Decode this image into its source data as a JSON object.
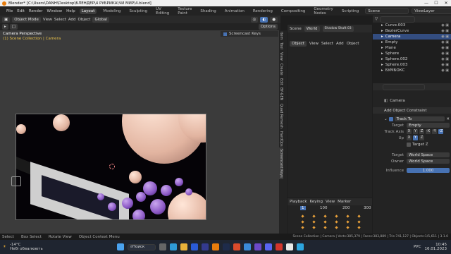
{
  "window": {
    "title": "Blender* [C:\\Users\\DANH\\Desktop\\БЛЕНДЕР\\4 РУБРИКА\\ЧИ МИР\\4.blend]",
    "controls": [
      "—",
      "☐",
      "✕"
    ]
  },
  "menu": {
    "items": [
      "File",
      "Edit",
      "Render",
      "Window",
      "Help"
    ],
    "workspaces": [
      "Layout",
      "Modeling",
      "Sculpting",
      "UV Editing",
      "Texture Paint",
      "Shading",
      "Animation",
      "Rendering",
      "Compositing",
      "Geometry Nodes",
      "Scripting"
    ],
    "active_workspace": "Layout",
    "scene": "Scene",
    "view_layer": "ViewLayer"
  },
  "viewport": {
    "mode": "Object Mode",
    "menus": [
      "View",
      "Select",
      "Add",
      "Object"
    ],
    "orientation": "Global",
    "options": "Options",
    "overlay_title": "Camera Perspective",
    "overlay_sub": "(1) Scene Collection | Camera"
  },
  "screencast": {
    "label": "Screencast Keys"
  },
  "sidebar_tabs": [
    "Item",
    "Tool",
    "View",
    "Create",
    "Edit",
    "BY-GEN",
    "Quad Remesh",
    "HardOps",
    "Screencast Keys"
  ],
  "mid_editor": {
    "label": "Scene",
    "sub": "Object",
    "menus": [
      "View",
      "Select",
      "Add",
      "Object"
    ],
    "world": "World",
    "dropdown": "Shadow Shaft 03"
  },
  "outliner": {
    "items": [
      {
        "name": "Curve.003",
        "sel": false
      },
      {
        "name": "BezierCurve",
        "sel": false
      },
      {
        "name": "Camera",
        "sel": true
      },
      {
        "name": "Empty",
        "sel": false
      },
      {
        "name": "Plane",
        "sel": false
      },
      {
        "name": "Sphere",
        "sel": false
      },
      {
        "name": "Sphere.002",
        "sel": false
      },
      {
        "name": "Sphere.003",
        "sel": false
      },
      {
        "name": "БУМБОКС",
        "sel": false
      }
    ]
  },
  "properties": {
    "object": "Camera",
    "add_constraint": "Add Object Constraint",
    "constraint_name": "Track To",
    "target_label": "Target",
    "target_value": "Empty",
    "track_axis_label": "Track Axis",
    "track_axes": [
      "X",
      "Y",
      "Z",
      "-X",
      "-Y",
      "-Z"
    ],
    "track_axis_active": "-Z",
    "up_label": "Up",
    "up_axes": [
      "X",
      "Y",
      "Z"
    ],
    "up_active": "Y",
    "target_z": "Target Z",
    "target_space_label": "Target",
    "target_space": "World Space",
    "owner_label": "Owner",
    "owner_space": "World Space",
    "influence_label": "Influence",
    "influence": "1.000"
  },
  "timeline": {
    "menus": [
      "Playback",
      "Keying",
      "View",
      "Marker"
    ],
    "frames": [
      "1",
      "100",
      "200",
      "300"
    ]
  },
  "status": {
    "left": [
      "Select",
      "Box Select",
      "Rotate View",
      "Object Context Menu"
    ],
    "right": "Scene Collection | Camera | Verts:385,379 | Faces:383,889 | Tris:741,127 | Objects:1/5,611 | 3.1.0"
  },
  "taskbar": {
    "weather_temp": "-14°C",
    "weather_desc": "Небі обвалюють",
    "search": "Поиск",
    "lang": "РУС",
    "time": "10:45",
    "date": "16.01.2023"
  }
}
